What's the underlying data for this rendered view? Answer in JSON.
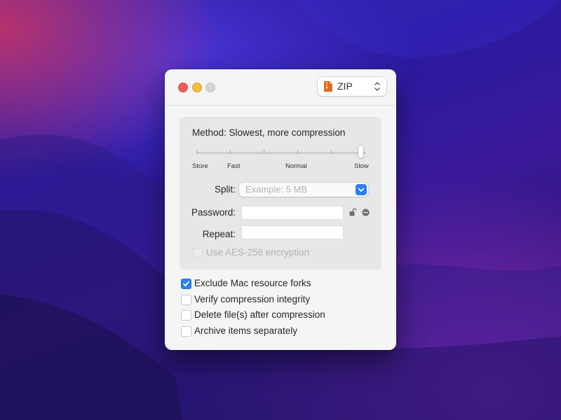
{
  "window": {
    "format": {
      "label": "ZIP",
      "icon": "zip-file-icon"
    }
  },
  "compression": {
    "method_label": "Method: Slowest, more compression",
    "level": 1.0,
    "ticks": {
      "store": "Store",
      "fast": "Fast",
      "normal": "Normal",
      "slow": "Slow"
    }
  },
  "split": {
    "label": "Split:",
    "placeholder": "Example: 5 MB"
  },
  "password": {
    "label": "Password:",
    "value": ""
  },
  "repeat": {
    "label": "Repeat:",
    "value": ""
  },
  "aes": {
    "label": "Use AES-256 encryption",
    "checked": false,
    "enabled": false
  },
  "options": [
    {
      "label": "Exclude Mac resource forks",
      "checked": true
    },
    {
      "label": "Verify compression integrity",
      "checked": false
    },
    {
      "label": "Delete file(s) after compression",
      "checked": false
    },
    {
      "label": "Archive items separately",
      "checked": false
    }
  ],
  "colors": {
    "accent": "#2d7ef0",
    "close": "#ee5e57",
    "minimize": "#f5be3b",
    "zip_icon": "#e36b1e"
  }
}
